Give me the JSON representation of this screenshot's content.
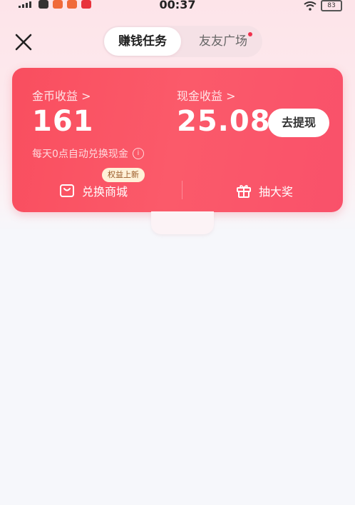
{
  "status_bar": {
    "time": "00:37",
    "battery": "83"
  },
  "header": {
    "close_icon": "close-icon",
    "tabs": [
      {
        "label": "赚钱任务",
        "active": true
      },
      {
        "label": "友友广场",
        "active": false,
        "has_dot": true
      }
    ]
  },
  "earnings": {
    "coin_label": "金币收益 >",
    "coin_value": "161",
    "cash_label": "现金收益 >",
    "cash_value": "25.08",
    "withdraw_label": "去提现",
    "exchange_note": "每天0点自动兑换现金",
    "actions": [
      {
        "label": "兑换商城",
        "icon": "shopping-bag-icon",
        "badge": "权益上新"
      },
      {
        "label": "抽大奖",
        "icon": "gift-icon"
      }
    ]
  },
  "colors": {
    "card_red": "#f94e5f",
    "accent_dot": "#f0324d",
    "badge_bg": "#fff1d8"
  }
}
